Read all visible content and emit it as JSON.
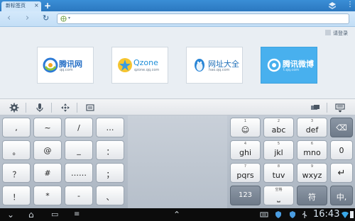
{
  "tabbar": {
    "tab_title": "新标签页",
    "close_glyph": "×",
    "new_tab_glyph": "+",
    "menu_glyph": "⋮",
    "icons": [
      "sync-icon",
      "overflow-menu-icon"
    ]
  },
  "addressbar": {
    "back_glyph": "‹",
    "forward_glyph": "›",
    "refresh_glyph": "↻",
    "url_value": "",
    "url_caret": "▾"
  },
  "content": {
    "login_label": "请登录",
    "tiles": [
      {
        "name": "腾讯网",
        "sub": "qq.com"
      },
      {
        "name": "Qzone",
        "sub": "qzone.qq.com"
      },
      {
        "name": "网址大全",
        "sub": "hao.qq.com"
      },
      {
        "name": "腾讯微博",
        "sub": "t.qq.com"
      }
    ]
  },
  "keyboard_toolbar": {
    "icons": [
      "settings-icon",
      "microphone-icon",
      "cursor-move-icon",
      "clipboard-icon",
      "clear-text-icon",
      "hide-keyboard-icon"
    ]
  },
  "keyboard": {
    "symbol_keys": [
      [
        ",",
        "~",
        "/",
        "…"
      ],
      [
        "。",
        "@",
        "_",
        "："
      ],
      [
        "？",
        "#",
        "……",
        "；"
      ],
      [
        "！",
        "*",
        "-",
        "、"
      ]
    ],
    "t9_keys": [
      {
        "num": "1",
        "label": "☺"
      },
      {
        "num": "2",
        "label": "abc"
      },
      {
        "num": "3",
        "label": "def"
      },
      {
        "num": "4",
        "label": "ghi"
      },
      {
        "num": "5",
        "label": "jkl"
      },
      {
        "num": "6",
        "label": "mno"
      },
      {
        "num": "7",
        "label": "pqrs"
      },
      {
        "num": "8",
        "label": "tuv"
      },
      {
        "num": "9",
        "label": "wxyz"
      }
    ],
    "key_123": "123",
    "key_space_num": "0",
    "key_space_label": "⎵",
    "key_space_caption": "空格",
    "key_symbol": "符",
    "key_lang": "中,",
    "key_backspace": "⌫",
    "key_zero": "0",
    "key_enter": "↵"
  },
  "statusbar": {
    "time": "16:43",
    "back_glyph": "⌄",
    "home_glyph": "⌂",
    "recents_glyph": "▭",
    "menu_glyph": "≡",
    "up_glyph": "⌃"
  },
  "colors": {
    "tab_bar": "#2b78c0",
    "address_bar": "#c3def6",
    "weibo_tile": "#48b0ee"
  }
}
